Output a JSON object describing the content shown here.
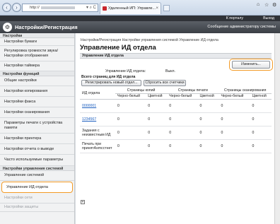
{
  "browser": {
    "url_prefix": "http://",
    "addr_icons": "▾ ⌕ C",
    "tab_title": "Удаленный ИП: Управле...",
    "tab_close": "×"
  },
  "header": {
    "portal_link": "К порталу",
    "logout_link": "Выход",
    "title": "Настройки/Регистрация",
    "admin_label": "Сообщение администратору системы"
  },
  "sidebar": {
    "sections": [
      {
        "label": "Настройки",
        "items": [
          {
            "label": "Настройки бумаги"
          },
          {
            "label": "Регулировка громкости звука/Настройки отображения"
          },
          {
            "label": "Настройки таймера"
          }
        ]
      },
      {
        "label": "Настройки функций",
        "items": [
          {
            "label": "Общие настройки"
          },
          {
            "label": "Настройки копирования"
          },
          {
            "label": "Настройки факса"
          },
          {
            "label": "Настройки сканирования"
          },
          {
            "label": "Параметры печати с устройства памяти"
          },
          {
            "label": "Настройки принтера"
          },
          {
            "label": "Настройки отчета о выводе"
          },
          {
            "label": "Часто используемые параметры"
          }
        ]
      },
      {
        "label": "Настройки управления системой",
        "items": [
          {
            "label": "Управление системой"
          },
          {
            "label": "Управление ИД отдела"
          },
          {
            "label": "Настройки сети"
          },
          {
            "label": "Настройки защиты"
          }
        ]
      }
    ]
  },
  "main": {
    "breadcrumb": "Настройки/Регистрация  Настройки управления системой  Управление ИД отдела",
    "title": "Управление ИД отдела",
    "section_bar": "Управление ИД отдела",
    "edit_button": "Изменить...",
    "mgmt_label": "Управление ИД отдела:",
    "mgmt_value": "Выкл.",
    "all_pages": "Всего страниц для ИД отдела",
    "register_button": "Регистрировать новый отдел...",
    "reset_button": "Сбросить все счетчики",
    "table": {
      "id_header": "ИД отдела",
      "groups": [
        "Страницы копий",
        "Страницы печати",
        "Страницы сканирования"
      ],
      "sub": [
        "Черно-белый",
        "Цветной",
        "Черно-белый",
        "Цветной",
        "Черно-белый",
        "Цветной"
      ],
      "rows": [
        {
          "id": "0000001",
          "link": true,
          "values": [
            "0",
            "0",
            "0",
            "0",
            "0",
            "0"
          ]
        },
        {
          "id": "1234567",
          "link": true,
          "values": [
            "0",
            "0",
            "0",
            "0",
            "0",
            "0"
          ]
        },
        {
          "id": "Задания с неизвестным ИД",
          "link": false,
          "values": [
            "0",
            "0",
            "0",
            "0",
            "0",
            "0"
          ]
        },
        {
          "id": "Печать при принятAsmccтнет",
          "link": false,
          "values": [
            "0",
            "0",
            "0",
            "0",
            "0",
            "0"
          ]
        }
      ]
    }
  }
}
